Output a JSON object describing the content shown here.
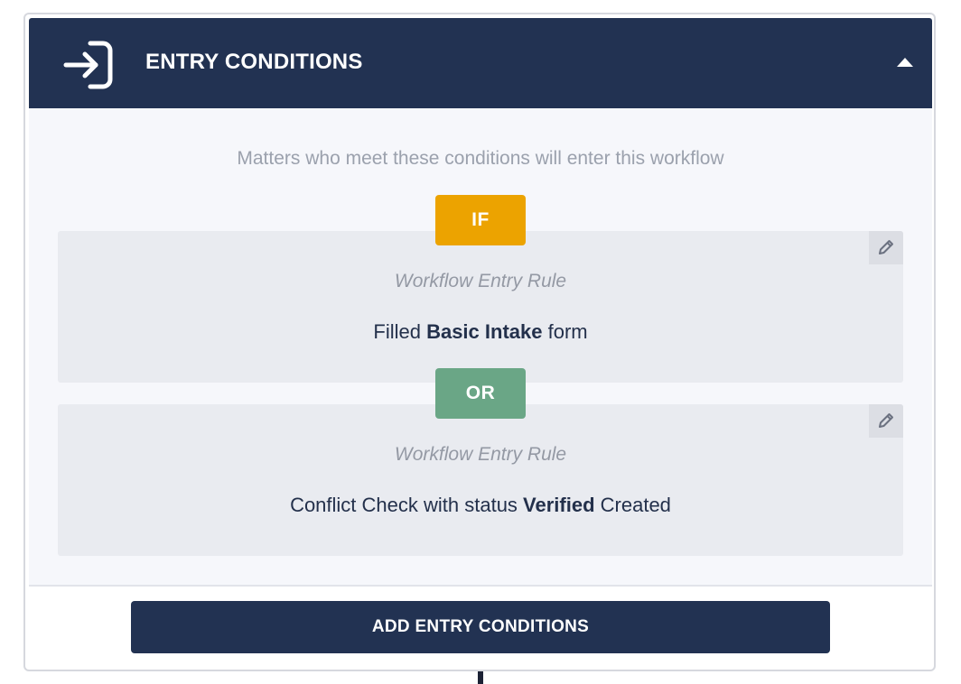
{
  "header": {
    "title": "ENTRY CONDITIONS",
    "icon": "sign-in-icon",
    "toggle_icon": "caret-up-icon"
  },
  "subtitle": "Matters who meet these conditions will enter this workflow",
  "operators": {
    "first": "IF",
    "joiner": "OR"
  },
  "rules": [
    {
      "label": "Workflow Entry Rule",
      "text_before": "Filled ",
      "text_bold": "Basic Intake",
      "text_after": " form",
      "edit_icon": "pencil-icon"
    },
    {
      "label": "Workflow Entry Rule",
      "text_before": "Conflict Check with status ",
      "text_bold": "Verified",
      "text_after": " Created",
      "edit_icon": "pencil-icon"
    }
  ],
  "footer": {
    "add_button_label": "ADD ENTRY CONDITIONS"
  },
  "colors": {
    "header_bg": "#223252",
    "if_badge": "#eca300",
    "or_badge": "#6aa686",
    "panel_bg": "#f6f7fb",
    "rule_bg": "#e9ebf0"
  }
}
